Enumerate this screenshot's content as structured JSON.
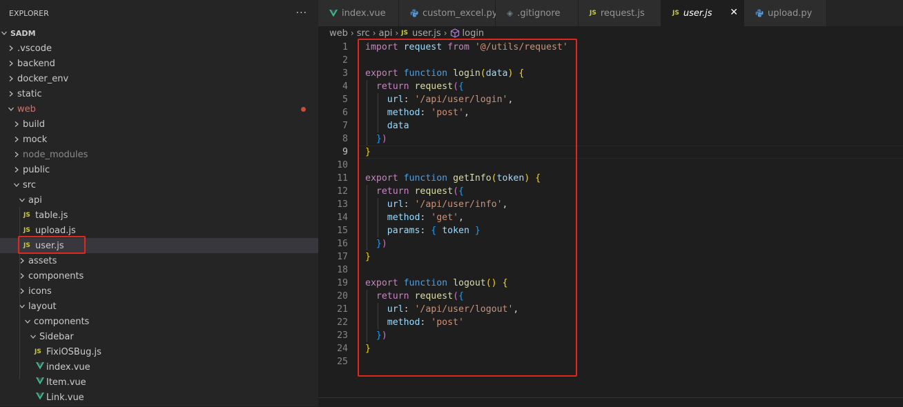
{
  "explorer": {
    "title": "EXPLORER",
    "more": "···",
    "items": [
      {
        "label": "SADM",
        "kind": "root"
      },
      {
        "label": ".vscode",
        "kind": "folder"
      },
      {
        "label": "backend",
        "kind": "folder"
      },
      {
        "label": "docker_env",
        "kind": "folder"
      },
      {
        "label": "static",
        "kind": "folder"
      },
      {
        "label": "web",
        "kind": "folder-open",
        "modified": true
      },
      {
        "label": "build",
        "kind": "folder"
      },
      {
        "label": "mock",
        "kind": "folder"
      },
      {
        "label": "node_modules",
        "kind": "folder",
        "muted": true
      },
      {
        "label": "public",
        "kind": "folder"
      },
      {
        "label": "src",
        "kind": "folder-open"
      },
      {
        "label": "api",
        "kind": "folder-open"
      },
      {
        "label": "table.js",
        "kind": "js"
      },
      {
        "label": "upload.js",
        "kind": "js"
      },
      {
        "label": "user.js",
        "kind": "js",
        "selected": true
      },
      {
        "label": "assets",
        "kind": "folder"
      },
      {
        "label": "components",
        "kind": "folder"
      },
      {
        "label": "icons",
        "kind": "folder"
      },
      {
        "label": "layout",
        "kind": "folder-open"
      },
      {
        "label": "components",
        "kind": "folder-open"
      },
      {
        "label": "Sidebar",
        "kind": "folder-open"
      },
      {
        "label": "FixiOSBug.js",
        "kind": "js"
      },
      {
        "label": "index.vue",
        "kind": "vue"
      },
      {
        "label": "Item.vue",
        "kind": "vue"
      },
      {
        "label": "Link.vue",
        "kind": "vue"
      }
    ],
    "js_icon": "JS"
  },
  "tabs": [
    {
      "label": "index.vue",
      "icon": "vue-icon"
    },
    {
      "label": "custom_excel.py",
      "icon": "python-icon"
    },
    {
      "label": ".gitignore",
      "icon": "git-icon"
    },
    {
      "label": "request.js",
      "icon": "js-icon"
    },
    {
      "label": "user.js",
      "icon": "js-icon",
      "active": true
    },
    {
      "label": "upload.py",
      "icon": "python-icon"
    }
  ],
  "tab_close": "✕",
  "breadcrumb": {
    "web": "web",
    "src": "src",
    "api": "api",
    "file": "user.js",
    "symbol": "login"
  },
  "editor": {
    "cursor_line": 9,
    "lines": [
      "import request from '@/utils/request'",
      "",
      "export function login(data) {",
      "  return request({",
      "    url: '/api/user/login',",
      "    method: 'post',",
      "    data",
      "  })",
      "}",
      "",
      "export function getInfo(token) {",
      "  return request({",
      "    url: '/api/user/info',",
      "    method: 'get',",
      "    params: { token }",
      "  })",
      "}",
      "",
      "export function logout() {",
      "  return request({",
      "    url: '/api/user/logout',",
      "    method: 'post'",
      "  })",
      "}",
      ""
    ]
  },
  "colors": {
    "highlight_box": "#e0291e",
    "modified": "#e06c60",
    "js_icon": "#cbcb41",
    "vue_icon": "#41b883",
    "python_icon": "#3d7ab3"
  }
}
